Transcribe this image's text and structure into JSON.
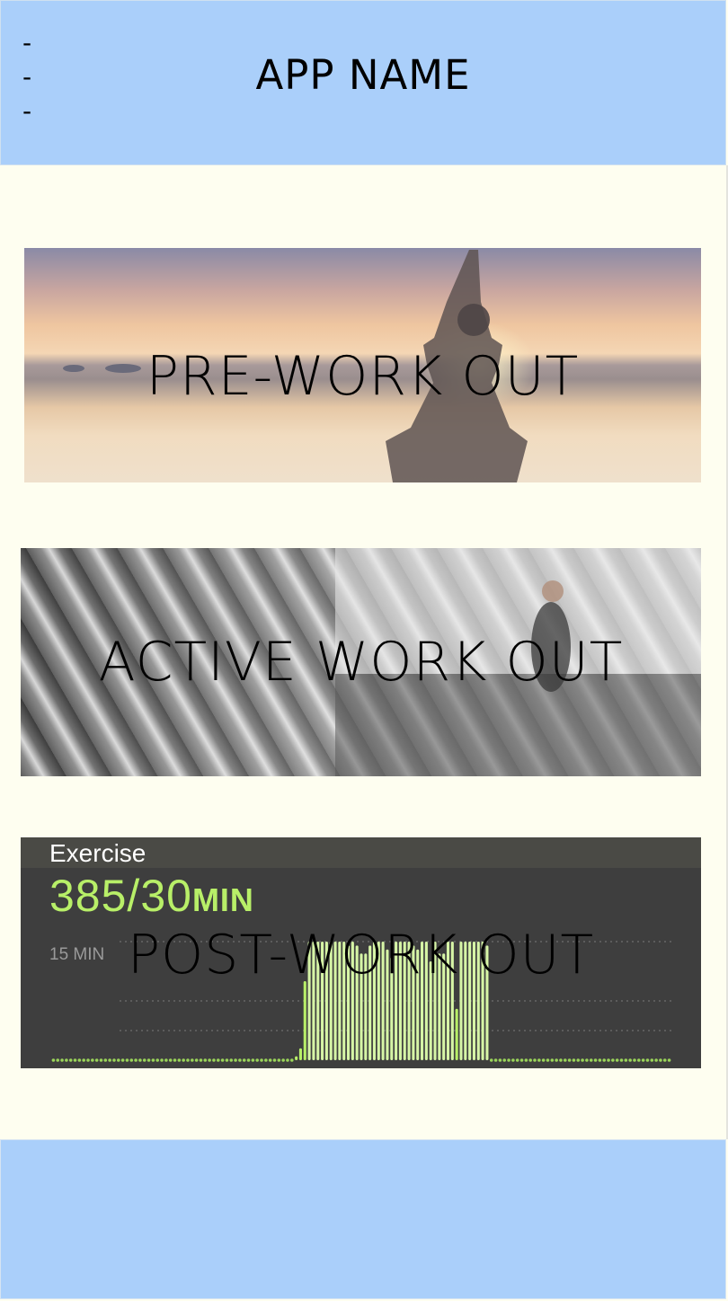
{
  "header": {
    "menu_icon": "hamburger-menu-icon",
    "menu_lines": [
      "-",
      "-",
      "-"
    ],
    "title": "APP NAME",
    "background_color": "#aacffa"
  },
  "cards": [
    {
      "id": "pre",
      "label": "PRE-WORK OUT",
      "image": "sunset-beach-yoga-photo"
    },
    {
      "id": "active",
      "label": "ACTIVE WORK OUT",
      "image": "gym-dumbbell-rack-photo"
    },
    {
      "id": "post",
      "label": "POST-WORK OUT",
      "image": "exercise-activity-chart"
    }
  ],
  "exercise_panel": {
    "title": "Exercise",
    "value": "385/30",
    "unit": "MIN",
    "gridline_label": "15 MIN",
    "accent_color": "#b8ef68"
  },
  "chart_data": {
    "type": "bar",
    "title": "",
    "xlabel": "",
    "ylabel": "",
    "ylim": [
      0,
      30
    ],
    "values": [
      0,
      0,
      0,
      0,
      0,
      0,
      0,
      0,
      0,
      0,
      0,
      0,
      0,
      0,
      0,
      0,
      0,
      0,
      0,
      0,
      0,
      0,
      0,
      0,
      0,
      0,
      0,
      0,
      0,
      0,
      0,
      0,
      0,
      0,
      0,
      0,
      0,
      0,
      0,
      0,
      0,
      0,
      0,
      0,
      0,
      0,
      0,
      0,
      0,
      0,
      0,
      0,
      0,
      0,
      0,
      0,
      1,
      3,
      20,
      30,
      30,
      30,
      30,
      30,
      30,
      30,
      30,
      30,
      29,
      30,
      29,
      27,
      27,
      29,
      30,
      30,
      30,
      28,
      26,
      30,
      30,
      30,
      30,
      29,
      28,
      30,
      30,
      25,
      30,
      27,
      27,
      30,
      30,
      13,
      30,
      30,
      30,
      30,
      30,
      30,
      29,
      0,
      0,
      0,
      0,
      0,
      0,
      0,
      0,
      0,
      0,
      0,
      0,
      0,
      0,
      0,
      0,
      0,
      0,
      0,
      0,
      0,
      0,
      0,
      0,
      0,
      0,
      0,
      0,
      0,
      0,
      0,
      0,
      0,
      0,
      0,
      0,
      0,
      0,
      0,
      0,
      0,
      0
    ]
  },
  "footer": {
    "background_color": "#aacffa"
  }
}
